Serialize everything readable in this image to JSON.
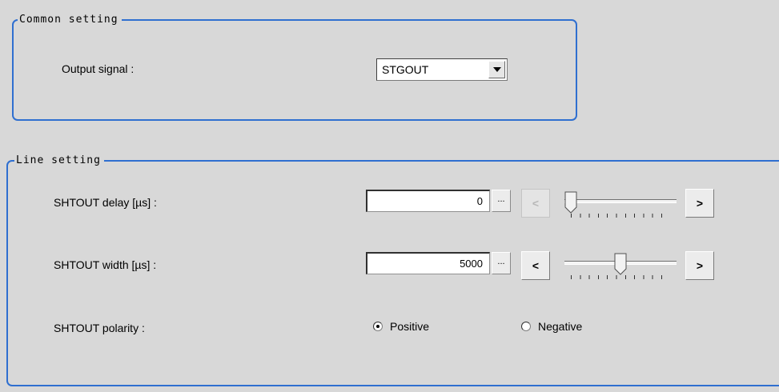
{
  "common_setting": {
    "title": "Common setting",
    "output_signal_label": "Output signal :",
    "output_signal_value": "STGOUT"
  },
  "line_setting": {
    "title": "Line setting",
    "delay": {
      "label": "SHTOUT delay [µs] :",
      "value": "0",
      "dots": "...",
      "dec": "<",
      "inc": ">",
      "dec_enabled": false,
      "slider_fraction": 0.0
    },
    "width": {
      "label": "SHTOUT width [µs] :",
      "value": "5000",
      "dots": "...",
      "dec": "<",
      "inc": ">",
      "dec_enabled": true,
      "slider_fraction": 0.5
    },
    "polarity": {
      "label": "SHTOUT polarity :",
      "options": [
        "Positive",
        "Negative"
      ],
      "selected": "Positive"
    }
  },
  "colors": {
    "background": "#d8d8d8",
    "group_border": "#2f6fd0"
  },
  "icons": {
    "dropdown": "triangle-down-icon",
    "slider_thumb": "pointer-thumb-icon"
  }
}
